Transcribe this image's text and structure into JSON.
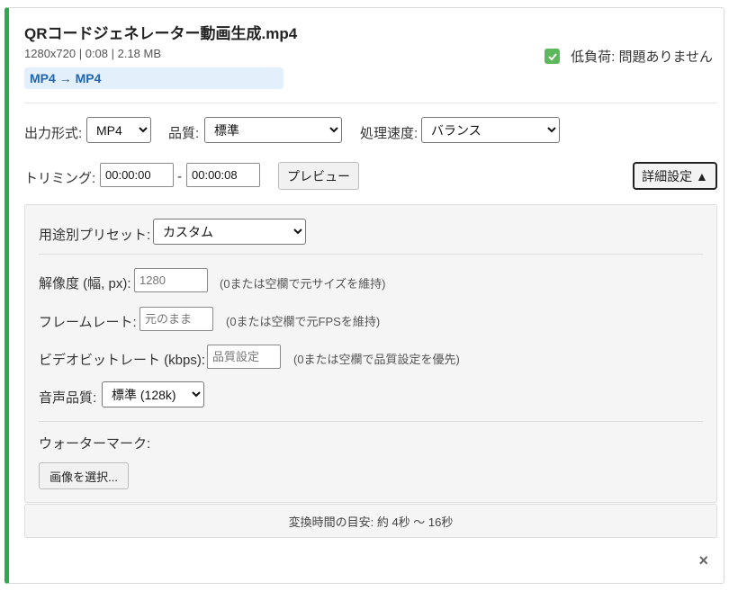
{
  "file": {
    "title": "QRコードジェネレーター動画生成.mp4",
    "meta": "1280x720 | 0:08 | 2.18 MB",
    "conversion": "MP4 → MP4"
  },
  "status": {
    "label": "低負荷: 問題ありません",
    "color": "#5cb85c",
    "icon": "check-icon"
  },
  "settings": {
    "format_label": "出力形式:",
    "format_value": "MP4",
    "quality_label": "品質:",
    "quality_value": "標準",
    "speed_label": "処理速度:",
    "speed_value": "バランス"
  },
  "trim": {
    "label": "トリミング:",
    "start": "00:00:00",
    "separator": "-",
    "end": "00:00:08",
    "preview_button": "プレビュー",
    "advanced_button": "詳細設定 ▲"
  },
  "advanced": {
    "preset_label": "用途別プリセット:",
    "preset_value": "カスタム",
    "resolution_label": "解像度 (幅, px):",
    "resolution_placeholder": "1280",
    "resolution_hint": "(0または空欄で元サイズを維持)",
    "framerate_label": "フレームレート:",
    "framerate_placeholder": "元のまま",
    "framerate_hint": "(0または空欄で元FPSを維持)",
    "bitrate_label": "ビデオビットレート (kbps):",
    "bitrate_placeholder": "品質設定",
    "bitrate_hint": "(0または空欄で品質設定を優先)",
    "audio_label": "音声品質:",
    "audio_value": "標準 (128k)",
    "watermark_label": "ウォーターマーク:",
    "watermark_button": "画像を選択..."
  },
  "estimate": "変換時間の目安: 約 4秒 〜 16秒",
  "close_icon": "×",
  "colors": {
    "accent": "#2fa84f",
    "conversion_text": "#1f66b3",
    "conversion_bg": "#e3f0fc"
  }
}
